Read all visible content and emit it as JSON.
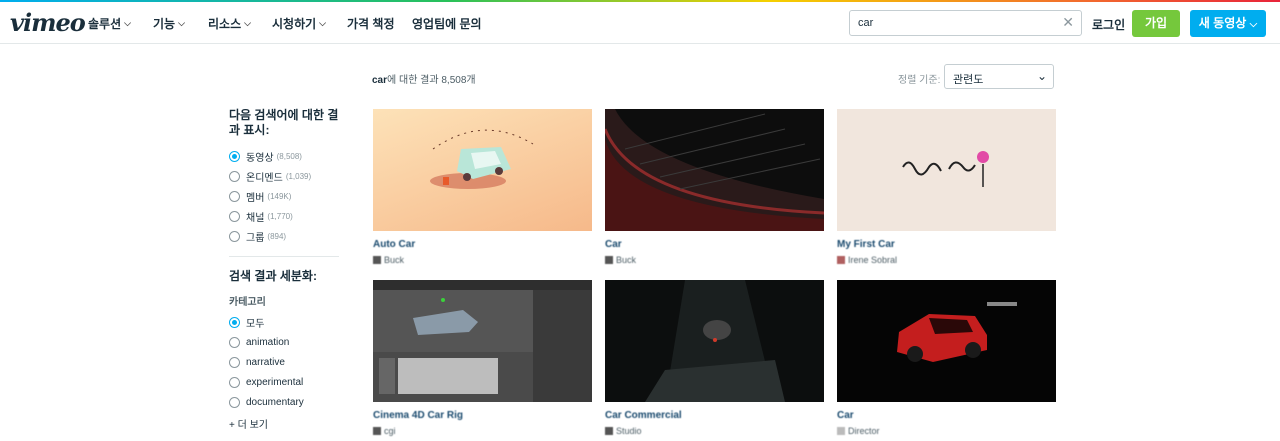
{
  "nav": {
    "logo": "vimeo",
    "items": [
      "솔루션",
      "기능",
      "리소스",
      "시청하기",
      "가격 책정",
      "영업팀에 문의"
    ],
    "search_value": "car",
    "login": "로그인",
    "join": "가입",
    "upload": "새 동영상"
  },
  "results": {
    "query": "car",
    "suffix": "에 대한 결과 8,508개",
    "sort_label": "정렬 기준:",
    "sort_value": "관련도"
  },
  "sidebar": {
    "title": "다음 검색어에 대한 결과 표시:",
    "types": [
      {
        "label": "동영상",
        "count": "(8,508)",
        "selected": true
      },
      {
        "label": "온디멘드",
        "count": "(1,039)",
        "selected": false
      },
      {
        "label": "멤버",
        "count": "(149K)",
        "selected": false
      },
      {
        "label": "채널",
        "count": "(1,770)",
        "selected": false
      },
      {
        "label": "그룹",
        "count": "(894)",
        "selected": false
      }
    ],
    "refine_title": "검색 결과 세분화:",
    "category_label": "카테고리",
    "categories": [
      {
        "label": "모두",
        "selected": true
      },
      {
        "label": "animation",
        "selected": false
      },
      {
        "label": "narrative",
        "selected": false
      },
      {
        "label": "experimental",
        "selected": false
      },
      {
        "label": "documentary",
        "selected": false
      }
    ],
    "more": "+ 더 보기"
  },
  "videos": [
    {
      "title": "Auto Car",
      "user": "Buck"
    },
    {
      "title": "Car",
      "user": "Buck"
    },
    {
      "title": "My First Car",
      "user": "Irene Sobral"
    },
    {
      "title": "Cinema 4D Car Rig",
      "user": "cgi"
    },
    {
      "title": "Car Commercial",
      "user": "Studio"
    },
    {
      "title": "Car",
      "user": "Director"
    }
  ]
}
